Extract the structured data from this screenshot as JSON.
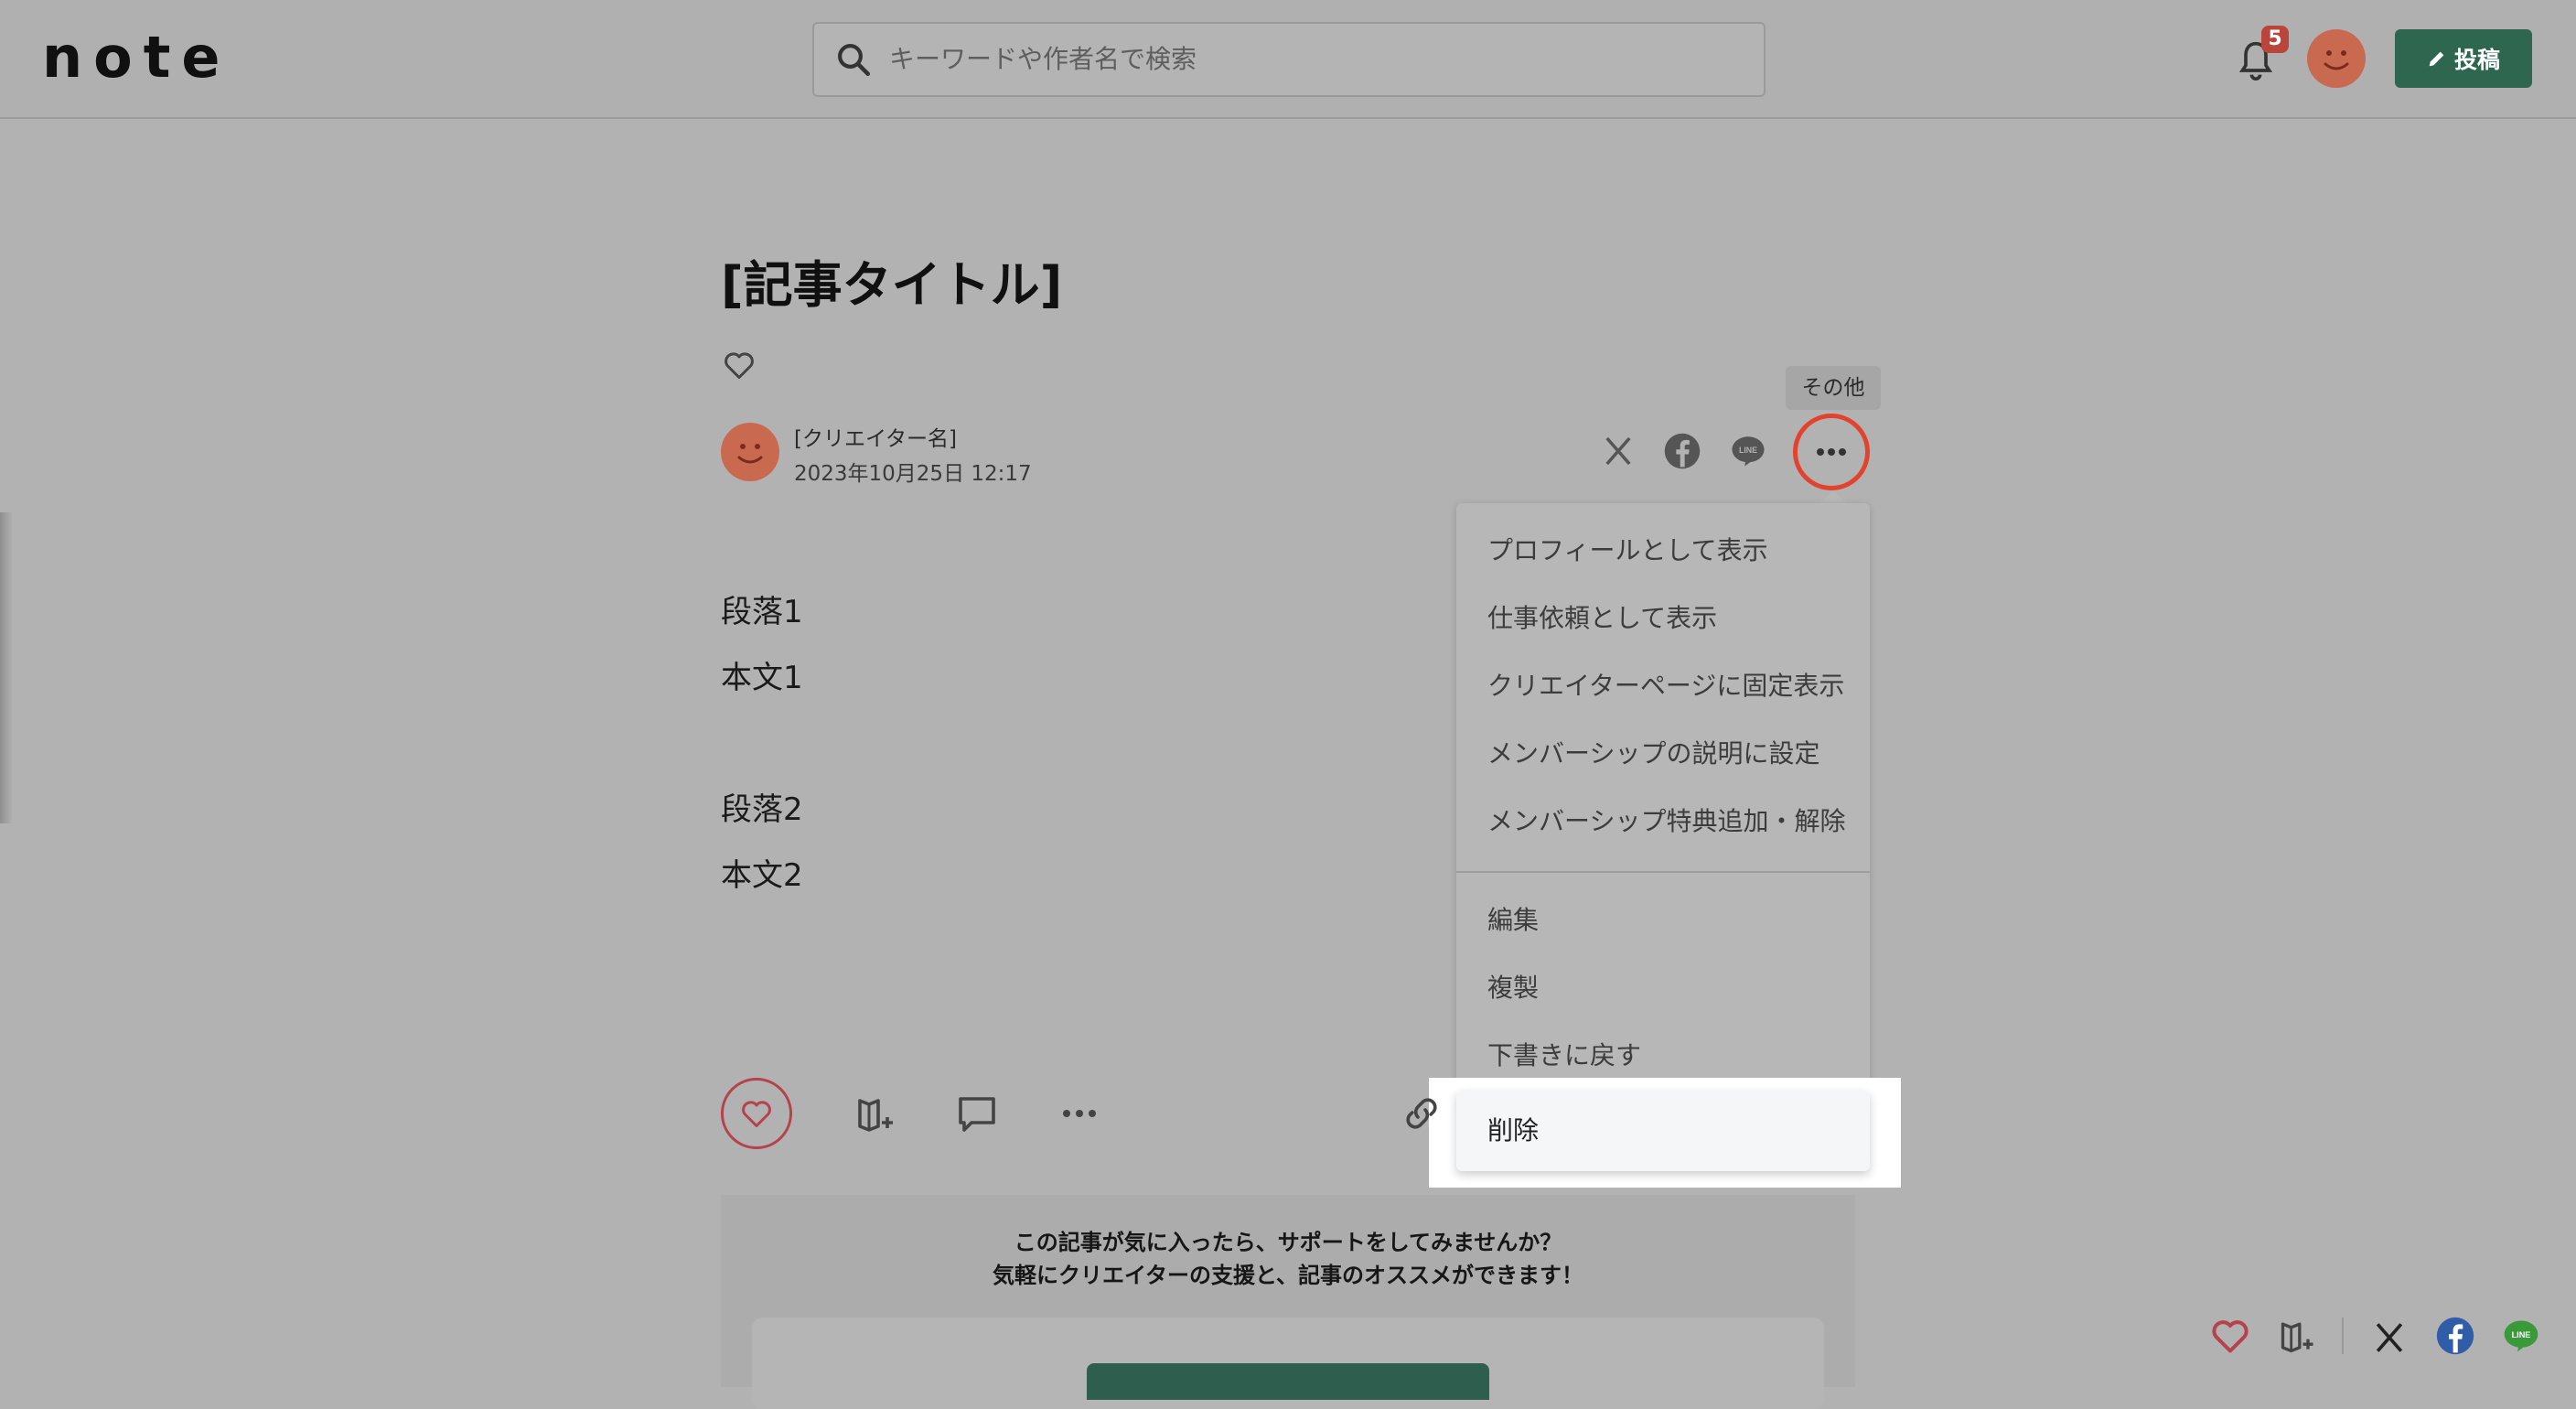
{
  "header": {
    "logo": "note",
    "search_placeholder": "キーワードや作者名で検索",
    "notification_count": "5",
    "post_button": "投稿"
  },
  "article": {
    "title": "[記事タイトル]",
    "author_name": "[クリエイター名]",
    "date": "2023年10月25日 12:17",
    "paragraphs": [
      {
        "heading": "段落1",
        "body": "本文1"
      },
      {
        "heading": "段落2",
        "body": "本文2"
      }
    ]
  },
  "tooltip": "その他",
  "menu": {
    "items": [
      "プロフィールとして表示",
      "仕事依頼として表示",
      "クリエイターページに固定表示",
      "メンバーシップの説明に設定",
      "メンバーシップ特典追加・解除"
    ],
    "items2": [
      "編集",
      "複製",
      "下書きに戻す",
      "削除"
    ]
  },
  "support": {
    "line1": "この記事が気に入ったら、サポートをしてみませんか？",
    "line2": "気軽にクリエイターの支援と、記事のオススメができます！"
  },
  "colors": {
    "accent_green": "#2e6650",
    "highlight_red": "#e2432f",
    "like_red": "#b5424c"
  }
}
